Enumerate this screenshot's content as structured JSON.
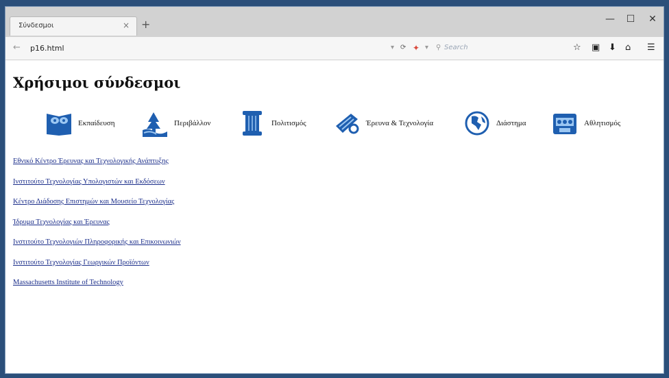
{
  "browser": {
    "tab_title": "Σύνδεσμοι",
    "tab_close": "×",
    "new_tab": "+",
    "url": "p16.html",
    "search_placeholder": "Search",
    "window_buttons": {
      "minimize": "—",
      "maximize": "☐",
      "close": "✕"
    }
  },
  "page": {
    "title": "Χρήσιμοι σύνδεσμοι",
    "categories": [
      {
        "label": "Εκπαίδευση",
        "icon": "education-icon"
      },
      {
        "label": "Περιβάλλον",
        "icon": "environment-icon"
      },
      {
        "label": "Πολιτισμός",
        "icon": "culture-icon"
      },
      {
        "label": "Έρευνα & Τεχνολογία",
        "icon": "research-icon"
      },
      {
        "label": "Διάστημα",
        "icon": "globe-icon"
      },
      {
        "label": "Αθλητισμός",
        "icon": "sports-icon"
      }
    ],
    "links": [
      "Εθνικό Κέντρο Έρευνας και Τεχνολογικής Ανάπτυξης",
      "Ινστιτούτο Τεχνολογίας Υπολογιστών και Εκδόσεων",
      "Κέντρο Διάδοσης Επιστημών και Μουσείο Τεχνολογίας",
      "Ίδρυμα Τεχνολογίας και Έρευνας",
      "Ινστιτούτο Τεχνολογιών Πληροφορικής και Επικοινωνιών",
      "Ινστιτούτο Τεχνολογίας Γεωργικών Προϊόντων",
      "Massachusetts Institute of Technology"
    ]
  },
  "colors": {
    "link": "#1a2d8a",
    "icon_blue": "#1f5fb0",
    "desktop": "#2b4f7a"
  }
}
